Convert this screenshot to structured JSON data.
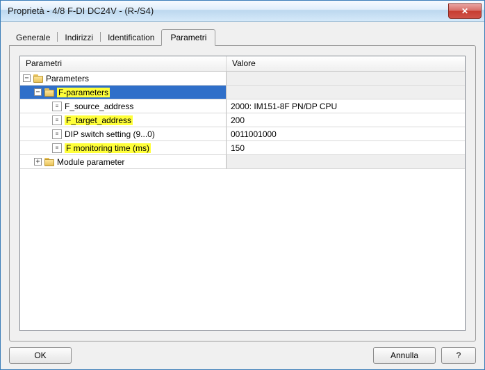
{
  "title": "Proprietà - 4/8 F-DI DC24V - (R-/S4)",
  "close_glyph": "✕",
  "tabs": {
    "generale": "Generale",
    "indirizzi": "Indirizzi",
    "identification": "Identification",
    "parametri": "Parametri"
  },
  "grid": {
    "header_param": "Parametri",
    "header_value": "Valore"
  },
  "tree": {
    "root": "Parameters",
    "fparams": "F-parameters",
    "f_source_addr": {
      "label": "F_source_address",
      "value": "2000: IM151-8F PN/DP CPU"
    },
    "f_target_addr": {
      "label": "F_target_address",
      "value": "200"
    },
    "dip_switch": {
      "label": "DIP switch setting (9...0)",
      "value": "0011001000"
    },
    "f_monitor": {
      "label": "F monitoring time (ms)",
      "value": "150"
    },
    "module_param": "Module parameter"
  },
  "buttons": {
    "ok": "OK",
    "annulla": "Annulla",
    "help": "?"
  }
}
